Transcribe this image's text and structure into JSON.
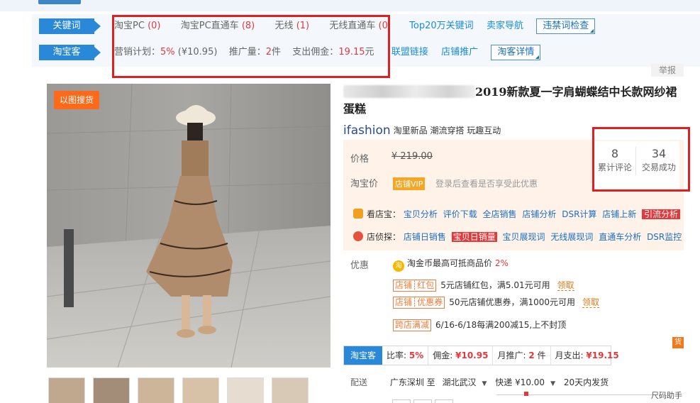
{
  "plugin": {
    "keyword_tag": "关键词",
    "taoke_tag": "淘宝客",
    "keyword_items": [
      {
        "label": "淘宝PC",
        "count": "(0)"
      },
      {
        "label": "淘宝PC直通车",
        "count": "(8)"
      },
      {
        "label": "无线",
        "count": "(1)"
      },
      {
        "label": "无线直通车",
        "count": "(0"
      }
    ],
    "keyword_links": [
      "Top20万关键词",
      "卖家导航"
    ],
    "violation_button": "违禁词检查",
    "taoke": {
      "plan_label": "营销计划：",
      "plan_rate": "5%",
      "plan_amount": "(¥10.95)",
      "promo_label": "推广量：",
      "promo_count": "2",
      "promo_unit": "件",
      "commission_label": "支出佣金：",
      "commission_value": "19.15",
      "commission_unit": "元"
    },
    "taoke_links": [
      "联盟链接",
      "店铺推广"
    ],
    "taoke_button": "淘客详情"
  },
  "report_label": "举报",
  "image_search_label": "以图搜货",
  "product": {
    "title": "2019新款夏一字肩蝴蝶结中长款网纱裙蛋糕",
    "brand_logo": "ifashion",
    "brand_tags": "淘里新品  潮流穿搭  玩趣互动"
  },
  "price": {
    "price_label": "价格",
    "original_price": "¥ 219.00",
    "taobao_price_label": "淘宝价",
    "vip_tag": "店铺VIP",
    "vip_text": "登录后查看是否享受此优惠"
  },
  "stats": {
    "reviews_count": "8",
    "reviews_label": "累计评论",
    "trades_count": "34",
    "trades_label": "交易成功"
  },
  "tools": {
    "kandianbao_label": "看店宝：",
    "kandianbao_links": [
      "宝贝分析",
      "评价下载",
      "全店销售",
      "店铺分析",
      "DSR计算",
      "店铺上新"
    ],
    "kandianbao_hot": "引流分析",
    "diantanzhen_label": "店侦探：",
    "diantanzhen_first": "店铺日销售",
    "diantanzhen_highlight": "宝贝日销量",
    "diantanzhen_links": [
      "宝贝展现词",
      "无线展现词",
      "直通车分析",
      "DSR监控"
    ]
  },
  "promo": {
    "label": "优惠",
    "coin_icon": "淘",
    "coin_text": "淘金币最高可抵商品价",
    "coin_rate": "2%",
    "coupons": [
      {
        "tag": "店铺┊红包",
        "text": "5元店铺红包，满5.01元可用",
        "claim": "领取"
      },
      {
        "tag": "店铺┊优惠券",
        "text": "50元店铺优惠券，满1000元可用",
        "claim": "领取"
      }
    ],
    "cross_tag": "跨店满减",
    "cross_text": "6/16-6/18每满200减15,上不封顶"
  },
  "taoke_icon": "货",
  "taoke_bar": {
    "tag": "淘宝客",
    "rate_label": "比率:",
    "rate_value": "5%",
    "commission_label": "佣金:",
    "commission_value": "¥10.95",
    "monthly_label": "月推广:",
    "monthly_value": "2",
    "monthly_unit": "件",
    "expense_label": "月支出:",
    "expense_value": "¥19.15"
  },
  "shipping": {
    "label": "配送",
    "from": "广东深圳 至",
    "to": "湖北武汉",
    "method": "快递 ¥10.00",
    "time": "20天内发货"
  },
  "size_helper": "尺码助手",
  "colors": {
    "accent_blue": "#2a88d8",
    "price_red": "#e4393c",
    "highlight_box": "#e02020",
    "image_search": "#ff6a1a"
  }
}
